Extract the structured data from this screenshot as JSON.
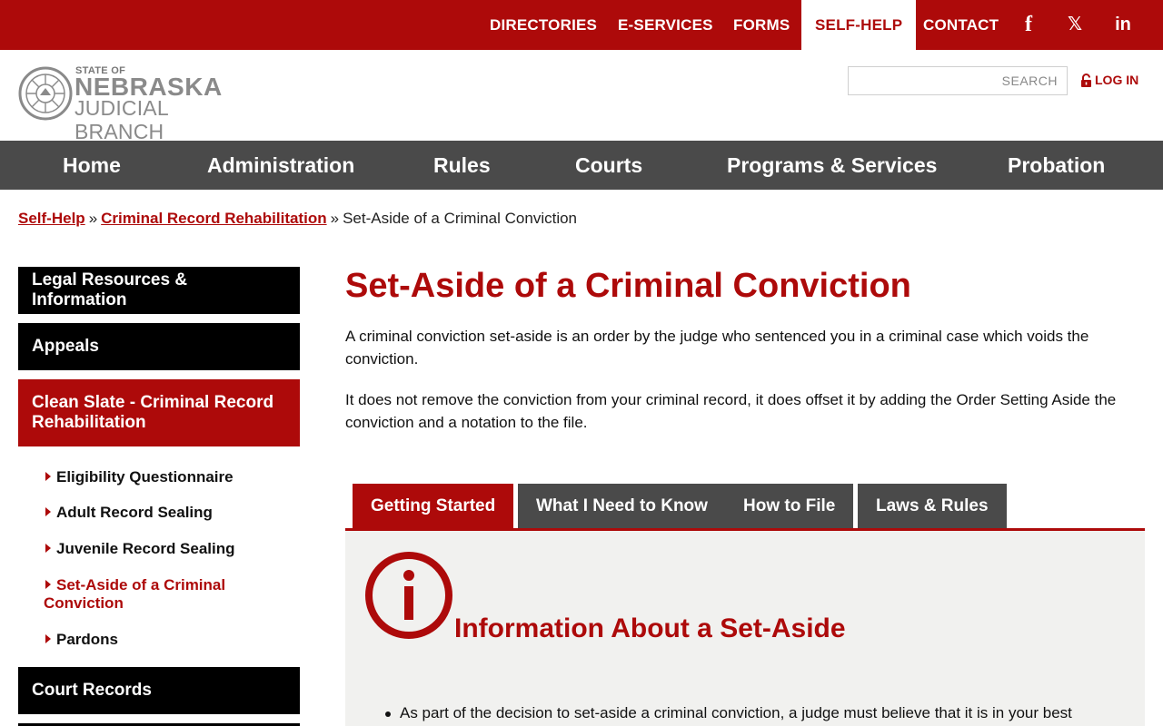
{
  "colors": {
    "brand_red": "#ad0a0a",
    "nav_gray": "#4a4a4a",
    "panel_bg": "#f1f1ef"
  },
  "topbar": {
    "links": [
      "DIRECTORIES",
      "E-SERVICES",
      "FORMS",
      "SELF-HELP",
      "CONTACT"
    ],
    "active": "SELF-HELP",
    "social": {
      "facebook": "f",
      "x": "𝕏",
      "linkedin": "in"
    }
  },
  "header": {
    "logo_small": "STATE OF",
    "logo_big": "NEBRASKA",
    "logo_sub": "JUDICIAL BRANCH",
    "search_placeholder": "SEARCH",
    "login_label": "LOG IN"
  },
  "mainnav": [
    "Home",
    "Administration",
    "Rules",
    "Courts",
    "Programs & Services",
    "Probation"
  ],
  "breadcrumb": {
    "items": [
      "Self-Help",
      "Criminal Record Rehabilitation"
    ],
    "separator": "»",
    "current": "Set-Aside of a Criminal Conviction"
  },
  "sidebar": {
    "blocks": [
      "Legal Resources & Information",
      "Appeals",
      "Clean Slate - Criminal Record Rehabilitation",
      "Court Records"
    ],
    "sub_items": [
      "Eligibility Questionnaire",
      "Adult Record Sealing",
      "Juvenile Record Sealing",
      "Set-Aside of a Criminal Conviction",
      "Pardons"
    ]
  },
  "content": {
    "title": "Set-Aside of a Criminal Conviction",
    "para1": "A criminal conviction set-aside is an order by the judge who sentenced you in a criminal case which voids the conviction.",
    "para2": "It does not remove the conviction from your criminal record, it does offset it by adding the Order Setting Aside the conviction and a notation to the file.",
    "tabs": [
      "Getting Started",
      "What I Need to Know",
      "How to File",
      "Laws & Rules"
    ],
    "active_tab": "Getting Started",
    "panel_heading": "Information About a Set-Aside",
    "bullet1": "As part of the decision to set-aside a criminal conviction, a judge must believe that it is in your best"
  }
}
